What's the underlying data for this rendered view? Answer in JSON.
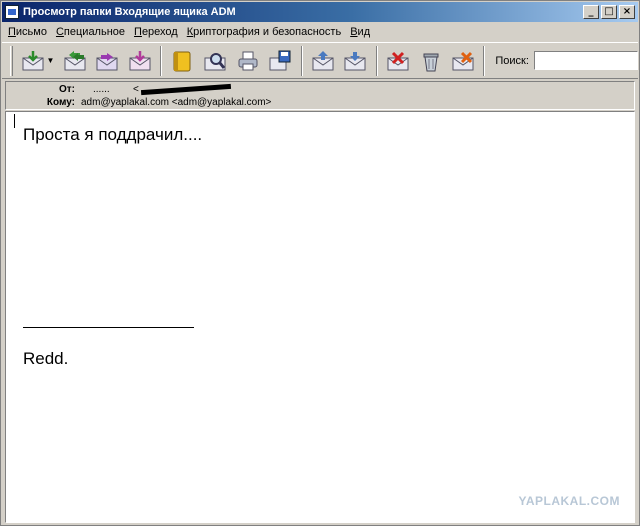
{
  "window": {
    "title": "Просмотр папки Входящие ящика ADM",
    "controls": [
      "_",
      "□",
      "×"
    ]
  },
  "menu": [
    "Письмо",
    "Специальное",
    "Переход",
    "Криптография и безопасность",
    "Вид"
  ],
  "toolbar": {
    "buttons": [
      "get-mail-icon",
      "reply-icon",
      "forward-icon",
      "new-message-icon",
      "address-book-icon",
      "find-icon",
      "print-icon",
      "save-icon",
      "move-icon",
      "copy-icon",
      "delete-icon",
      "trash-icon",
      "junk-icon"
    ],
    "search_label": "Поиск:",
    "search_value": ""
  },
  "headers": {
    "from_label": "От:",
    "from_name": "......",
    "from_addr_prefix": "<",
    "to_label": "Кому:",
    "to_value": "adm@yaplakal.com <adm@yaplakal.com>"
  },
  "message": {
    "line1": "Проста я поддрачил....",
    "signature": "Redd."
  },
  "watermark": "YAPLAKAL.COM"
}
